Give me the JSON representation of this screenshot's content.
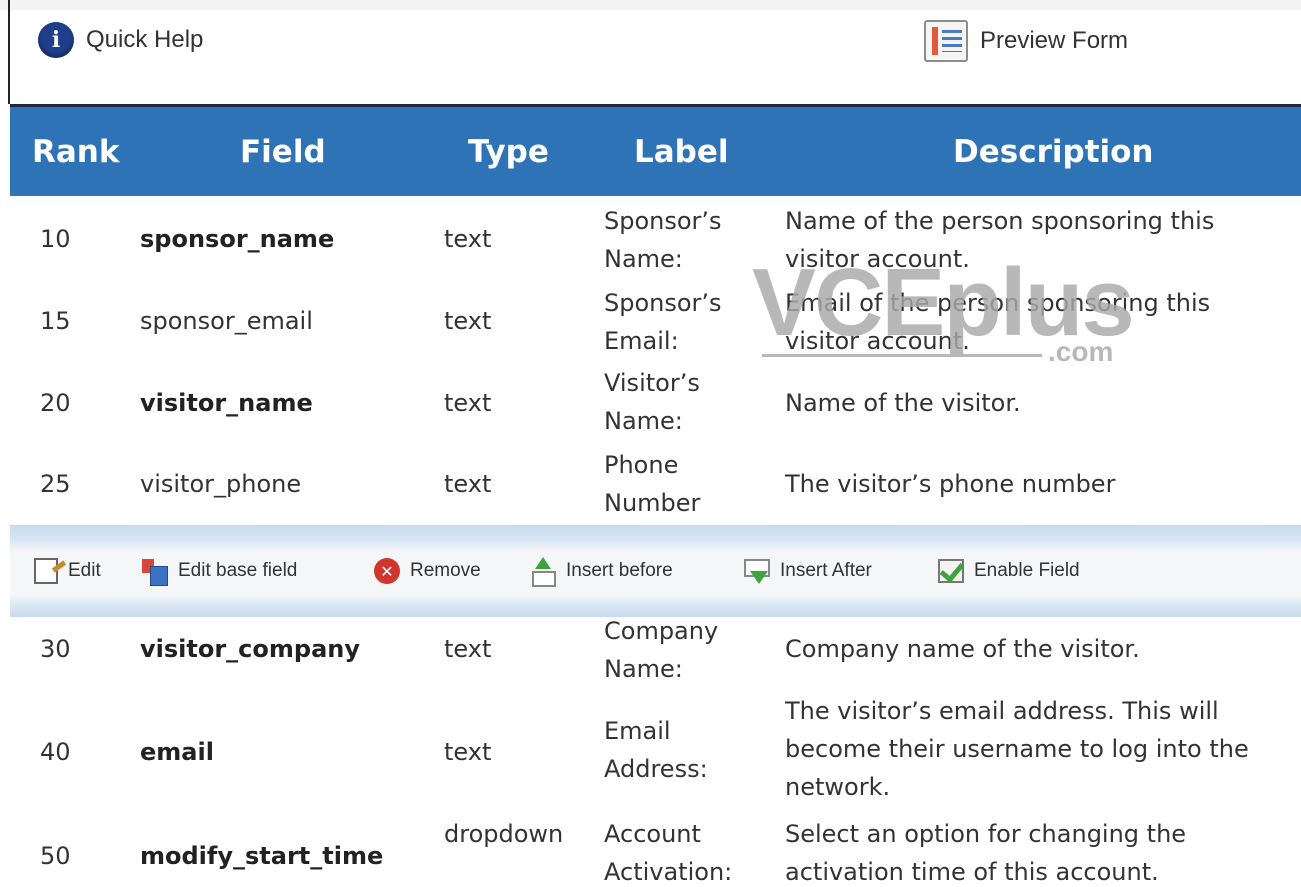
{
  "topbar": {
    "quick_help": "Quick Help",
    "preview_form": "Preview Form",
    "info_glyph": "i"
  },
  "table": {
    "columns": [
      "Rank",
      "Field",
      "Type",
      "Label",
      "Description"
    ],
    "rows_before_toolbar": [
      {
        "rank": "10",
        "field": "sponsor_name",
        "bold": true,
        "type": "text",
        "label": "Sponsor’s Name:",
        "description": "Name of the person sponsoring this visitor account."
      },
      {
        "rank": "15",
        "field": "sponsor_email",
        "bold": false,
        "type": "text",
        "label": "Sponsor’s Email:",
        "description": "Email of the person sponsoring this visitor account."
      },
      {
        "rank": "20",
        "field": "visitor_name",
        "bold": true,
        "type": "text",
        "label": "Visitor’s Name:",
        "description": "Name of the visitor."
      },
      {
        "rank": "25",
        "field": "visitor_phone",
        "bold": false,
        "type": "text",
        "label": "Phone Number",
        "description": "The visitor’s phone number"
      }
    ],
    "rows_after_toolbar": [
      {
        "rank": "30",
        "field": "visitor_company",
        "bold": true,
        "type": "text",
        "label": "Company Name:",
        "description": "Company name of the visitor."
      },
      {
        "rank": "40",
        "field": "email",
        "bold": true,
        "type": "text",
        "label": "Email Address:",
        "description": "The visitor’s email address. This will become their username to log into the network."
      },
      {
        "rank": "50",
        "field": "modify_start_time",
        "bold": true,
        "type": "dropdown",
        "label": "Account Activation:",
        "description": "Select an option for changing the activation time of this account."
      }
    ]
  },
  "toolbar": {
    "edit": "Edit",
    "edit_base_field": "Edit base field",
    "remove": "Remove",
    "insert_before": "Insert before",
    "insert_after": "Insert After",
    "enable_field": "Enable Field",
    "remove_glyph": "✕"
  },
  "watermark": {
    "text": "VCEplus",
    "suffix": ".com"
  },
  "colors": {
    "header_blue": "#2f73b7",
    "toolbar_band": "#c8dbee",
    "text": "#333333"
  }
}
